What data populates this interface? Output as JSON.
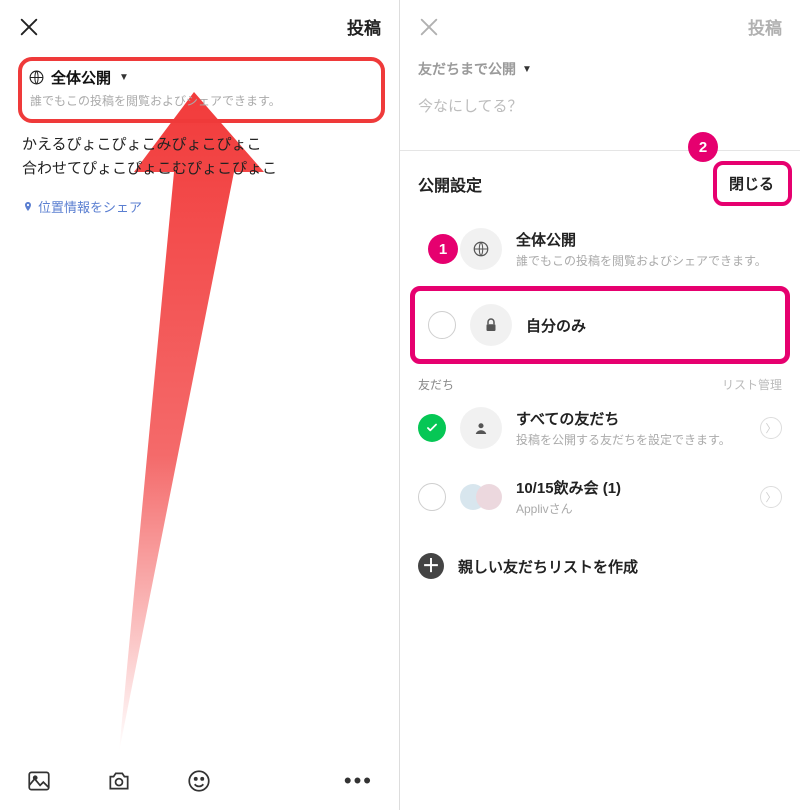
{
  "left": {
    "post_label": "投稿",
    "privacy_title": "全体公開",
    "privacy_sub": "誰でもこの投稿を閲覧およびシェアできます。",
    "compose_line1": "かえるぴょこぴょこみぴょこぴょこ",
    "compose_line2": "合わせてぴょこぴょこむぴょこぴょこ",
    "location_label": "位置情報をシェア"
  },
  "right": {
    "post_label": "投稿",
    "privacy_title": "友だちまで公開",
    "placeholder": "今なにしてる？",
    "sheet_title": "公開設定",
    "close_label": "閉じる",
    "badges": {
      "one": "1",
      "two": "2"
    },
    "options": {
      "public": {
        "title": "全体公開",
        "sub": "誰でもこの投稿を閲覧およびシェアできます。"
      },
      "self": {
        "title": "自分のみ"
      }
    },
    "friends_section": {
      "label": "友だち",
      "manage": "リスト管理"
    },
    "friends_all": {
      "title": "すべての友だち",
      "sub": "投稿を公開する友だちを設定できます。"
    },
    "friend_group": {
      "title": "10/15飲み会 (1)",
      "sub": "Applivさん"
    },
    "add_list": "親しい友だちリストを作成"
  }
}
